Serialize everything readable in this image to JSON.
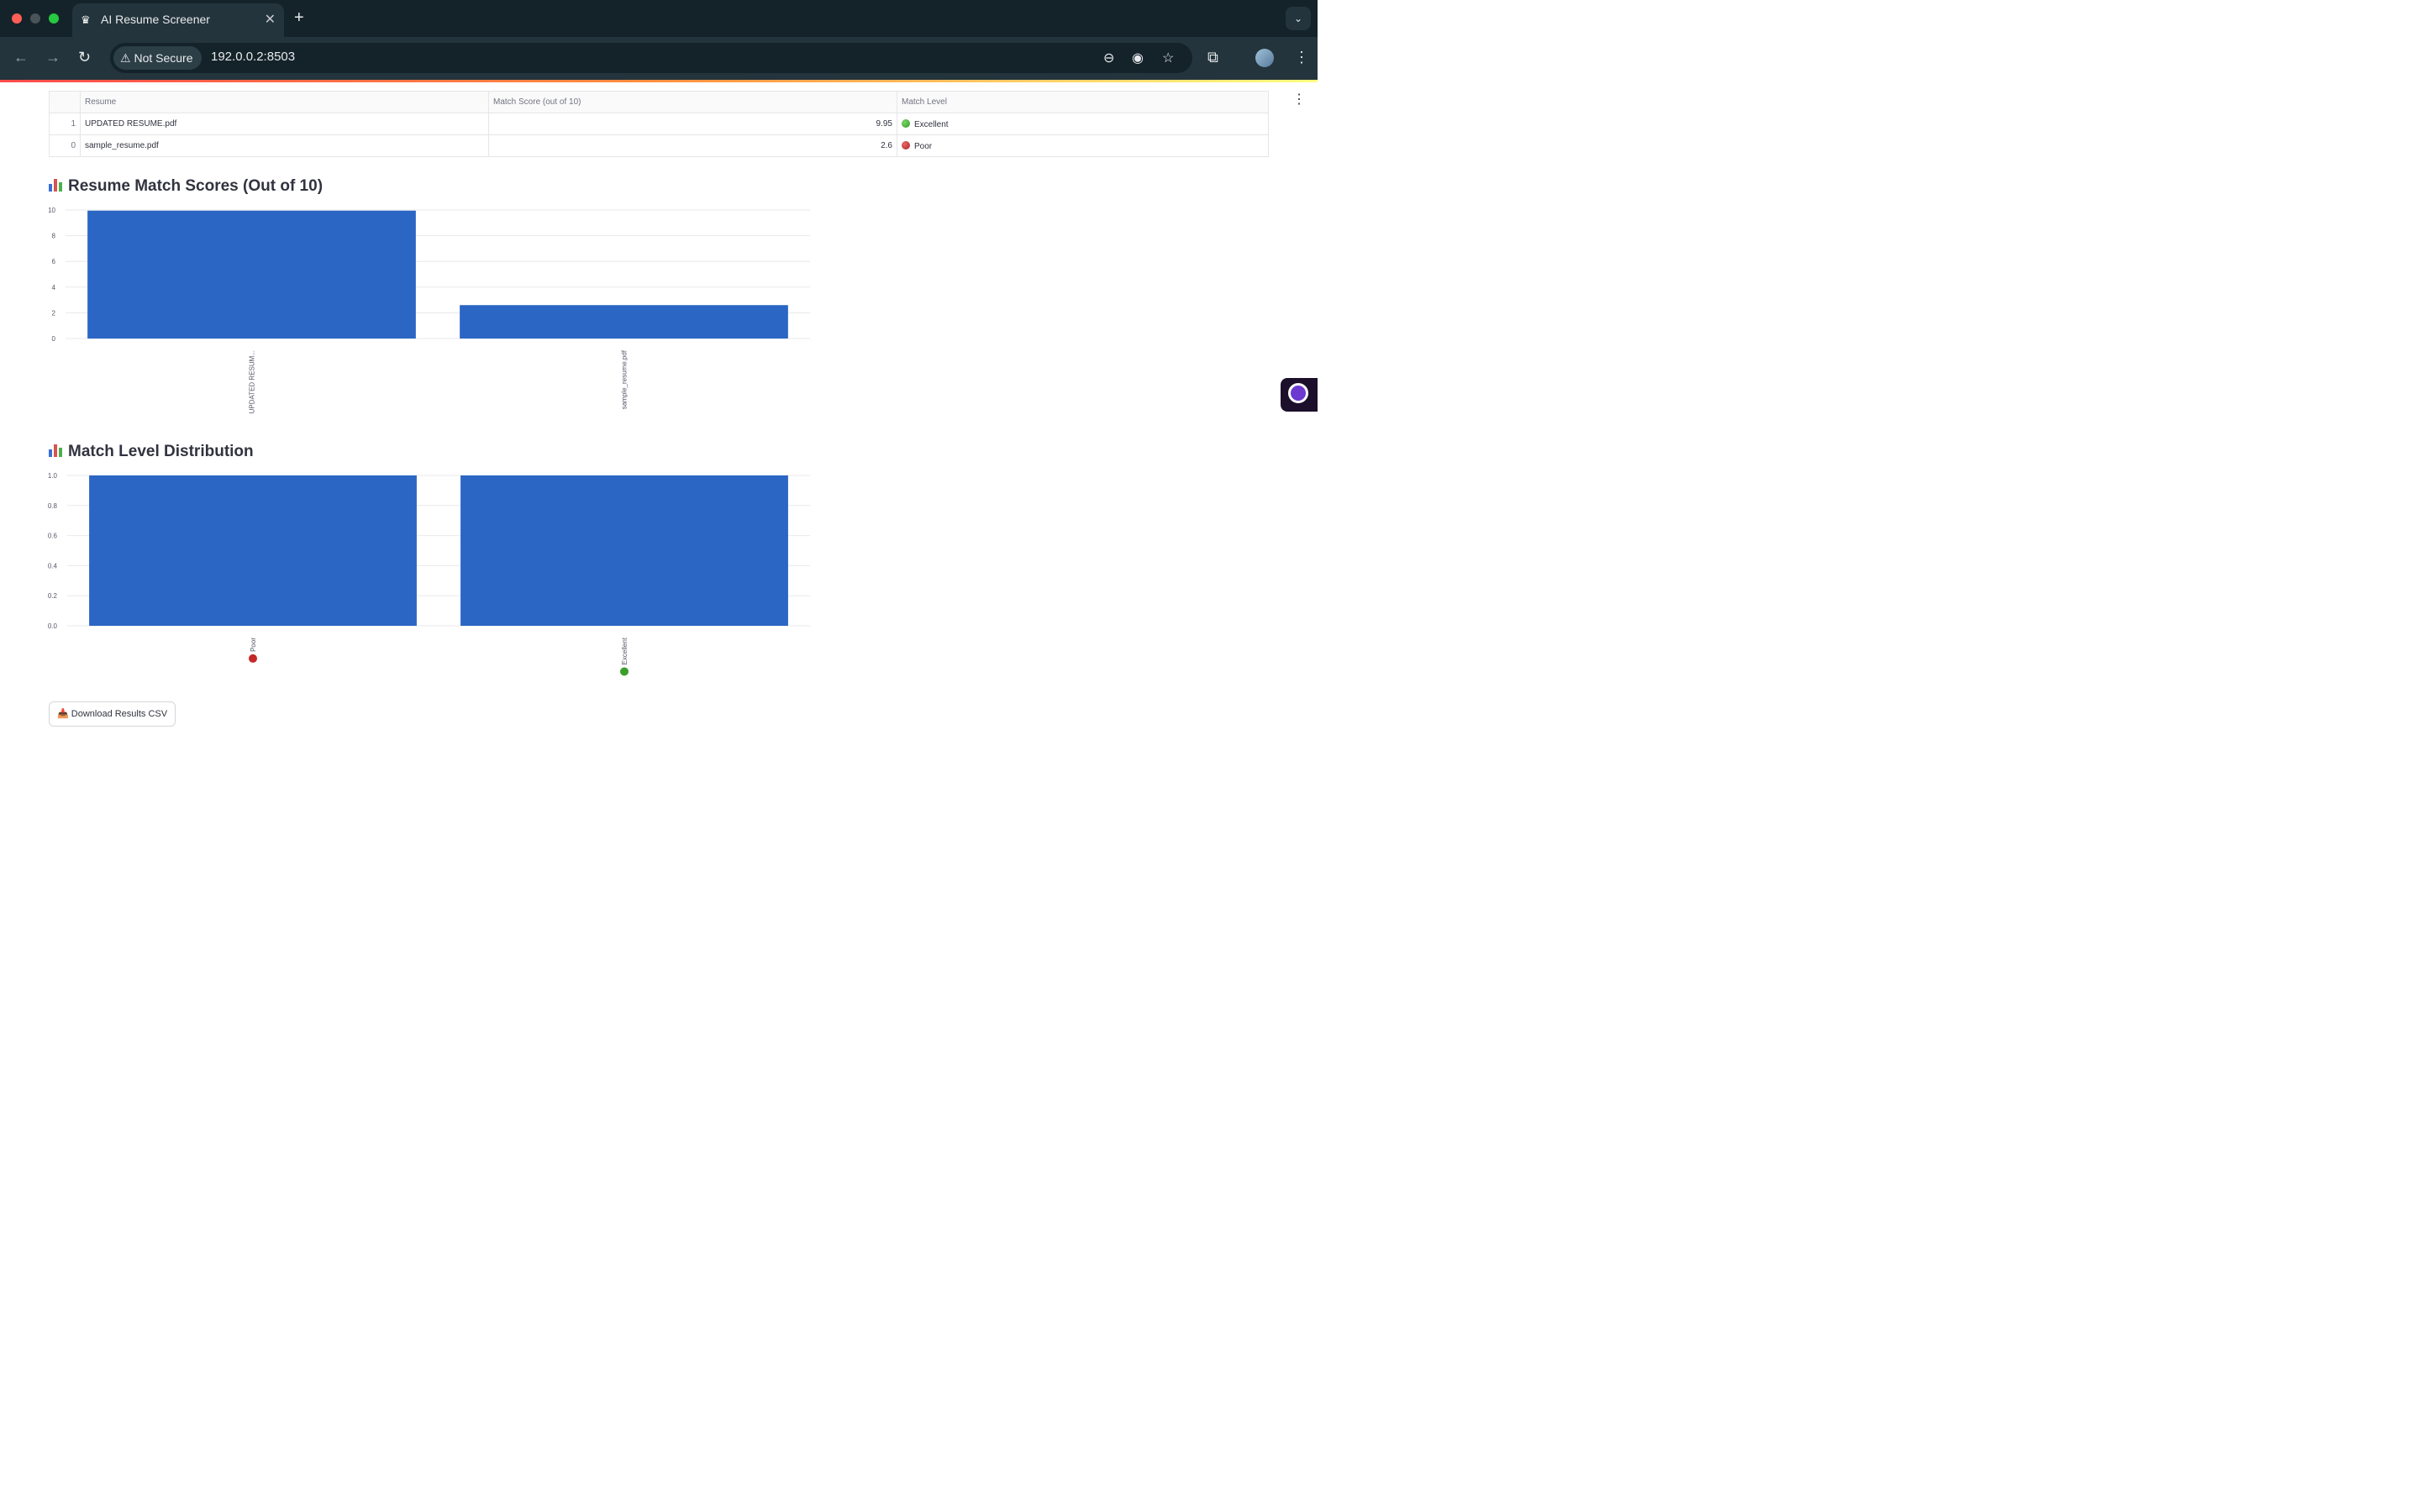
{
  "browser": {
    "tab_title": "AI Resume Screener",
    "security_label": "Not Secure",
    "url": "192.0.0.2:8503"
  },
  "table": {
    "headers": [
      "Resume",
      "Match Score (out of 10)",
      "Match Level"
    ],
    "rows": [
      {
        "index": "1",
        "resume": "UPDATED RESUME.pdf",
        "score": "9.95",
        "level": "Excellent",
        "level_color": "#3a9f2a"
      },
      {
        "index": "0",
        "resume": "sample_resume.pdf",
        "score": "2.6",
        "level": "Poor",
        "level_color": "#c62828"
      }
    ]
  },
  "sections": {
    "scores_title": "Resume Match Scores (Out of 10)",
    "distribution_title": "Match Level Distribution"
  },
  "download_button": "Download Results CSV",
  "chart_data": [
    {
      "type": "bar",
      "categories": [
        "UPDATED RESUM...",
        "sample_resume.pdf"
      ],
      "values": [
        9.95,
        2.6
      ],
      "ylim": [
        0,
        10
      ],
      "yticks": [
        0,
        2,
        4,
        6,
        8,
        10
      ],
      "grid": true,
      "bar_color": "#2b66c4"
    },
    {
      "type": "bar",
      "categories": [
        "Poor",
        "Excellent"
      ],
      "category_markers": [
        "red-circle",
        "green-circle"
      ],
      "values": [
        1,
        1
      ],
      "ylim": [
        0,
        1
      ],
      "yticks": [
        "0.0",
        "0.2",
        "0.4",
        "0.6",
        "0.8",
        "1.0"
      ],
      "grid": true,
      "bar_color": "#2b66c4"
    }
  ]
}
